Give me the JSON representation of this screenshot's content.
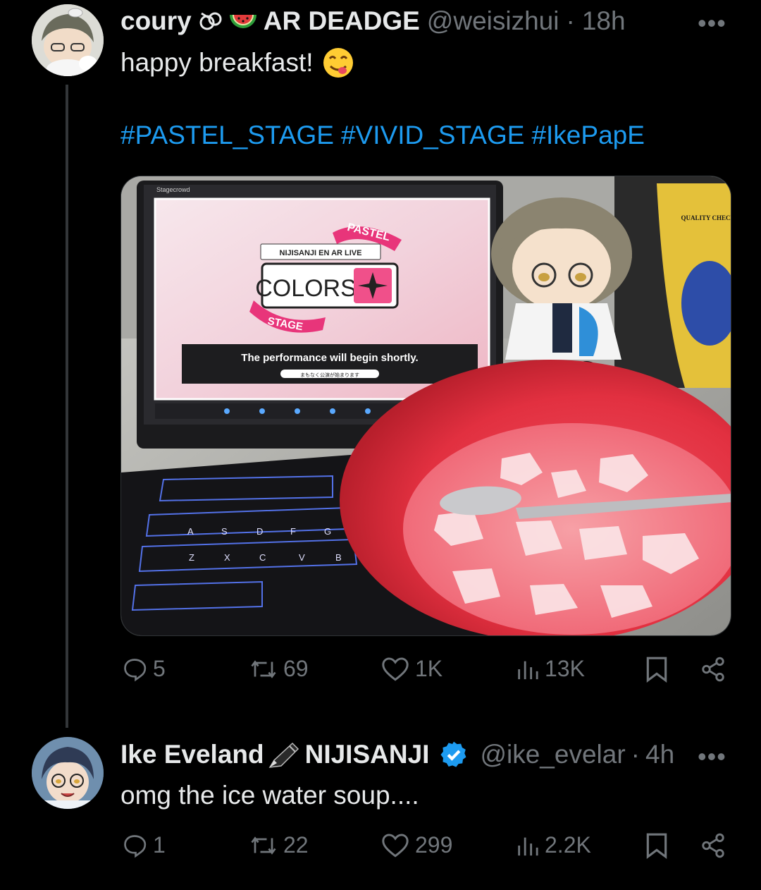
{
  "tweet": {
    "display_name": "coury",
    "name_emojis": [
      "ribbon-icon",
      "watermelon-icon"
    ],
    "name_suffix": "AR DEADGE",
    "handle": "@weisizhui",
    "separator": "·",
    "time": "18h",
    "more_label": "•••",
    "text": "happy breakfast!",
    "text_emoji": "yum-face-icon",
    "hashtags": [
      "#PASTEL_STAGE",
      "#VIVID_STAGE",
      "#IkePapE"
    ],
    "media": {
      "laptop_screen": {
        "top_label": "Stagecrowd",
        "banner_title": "NIJISANJI EN AR LIVE",
        "logo_text": "COLORS",
        "ribbon_top": "PASTEL",
        "ribbon_bottom": "STAGE",
        "message": "The performance will begin shortly.",
        "sub_message": "まもなく公演が始まります"
      },
      "keyboard_keys": [
        "Z",
        "X",
        "C",
        "V",
        "B",
        "A",
        "S",
        "D",
        "F",
        "G"
      ],
      "badge_text": "QUALITY CHECK"
    },
    "actions": {
      "replies": "5",
      "reposts": "69",
      "likes": "1K",
      "views": "13K"
    }
  },
  "reply": {
    "display_name": "Ike Eveland",
    "name_suffix": "NIJISANJI",
    "name_emoji": "fountain-pen-icon",
    "verified": true,
    "handle": "@ike_evelar",
    "separator": "·",
    "time": "4h",
    "more_label": "•••",
    "text": "omg the ice water soup....",
    "actions": {
      "replies": "1",
      "reposts": "22",
      "likes": "299",
      "views": "2.2K"
    }
  },
  "colors": {
    "background": "#000000",
    "text": "#e7e9ea",
    "muted": "#71767b",
    "link": "#1d9bf0",
    "verified": "#1d9bf0",
    "thread_line": "#333639"
  }
}
